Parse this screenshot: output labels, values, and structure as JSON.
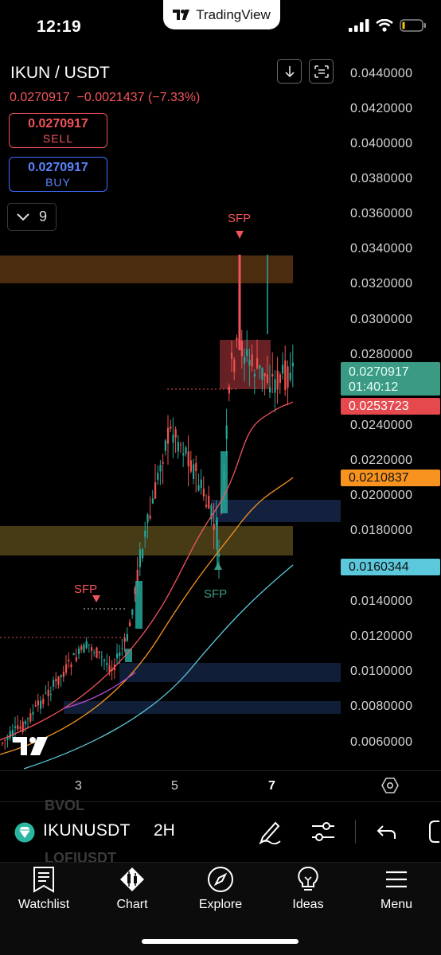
{
  "status_bar": {
    "time": "12:19",
    "app_name": "TradingView"
  },
  "header": {
    "pair": "IKUN / USDT",
    "last_price": "0.0270917",
    "change": "−0.0021437",
    "change_pct": "(−7.33%)",
    "sell": {
      "price": "0.0270917",
      "label": "SELL"
    },
    "buy": {
      "price": "0.0270917",
      "label": "BUY"
    },
    "indicator_count": "9"
  },
  "price_axis": {
    "ticks": [
      "0.0440000",
      "0.0420000",
      "0.0400000",
      "0.0380000",
      "0.0360000",
      "0.0340000",
      "0.0320000",
      "0.0300000",
      "0.0280000",
      "0.0240000",
      "0.0220000",
      "0.0200000",
      "0.0180000",
      "0.0140000",
      "0.0120000",
      "0.0100000",
      "0.0080000",
      "0.0060000"
    ],
    "labels": [
      {
        "value": "0.0270917",
        "sub": "01:40:12",
        "color": "#3b9a84"
      },
      {
        "value": "0.0253723",
        "color": "#e5484d"
      },
      {
        "value": "0.0210837",
        "color": "#f7931e"
      },
      {
        "value": "0.0160344",
        "color": "#5bc8db"
      }
    ]
  },
  "annotations": {
    "sfp_top": "SFP",
    "sfp_left": "SFP",
    "sfp_green": "SFP"
  },
  "time_axis": {
    "ticks": [
      "3",
      "5",
      "7"
    ]
  },
  "toolbar": {
    "symbol": "IKUNUSDT",
    "interval": "2H",
    "ghost_top": "BVOL",
    "ghost_bottom": "LOFIUSDT"
  },
  "bottom_nav": [
    "Watchlist",
    "Chart",
    "Explore",
    "Ideas",
    "Menu"
  ],
  "colors": {
    "up": "#26a69a",
    "down": "#ef5350",
    "accent_red": "#f2545b",
    "accent_blue": "#3d6fff"
  }
}
